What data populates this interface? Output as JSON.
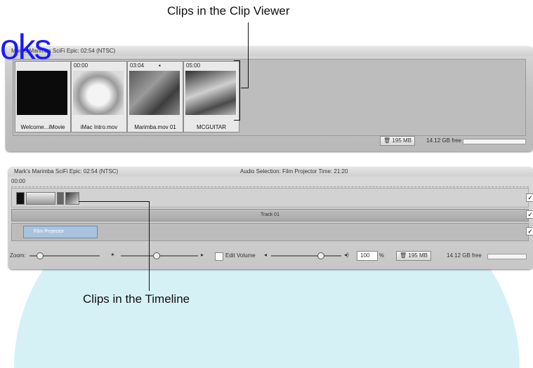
{
  "callouts": {
    "clip_viewer": "Clips in the Clip Viewer",
    "timeline": "Clips in the Timeline"
  },
  "overlay_brand": "oks",
  "clip_viewer": {
    "title": "Mark's Marimba SciFi Epic: 02:54 (NTSC)",
    "clips": [
      {
        "time": "",
        "name": "Welcome...iMovie"
      },
      {
        "time": "00:00",
        "name": "iMac Intro.mov"
      },
      {
        "time": "03:04",
        "name": "Marimba.mov 01"
      },
      {
        "time": "05:00",
        "name": "MCGUITAR"
      }
    ],
    "storage": "195 MB",
    "free": "14.12 GB free"
  },
  "timeline": {
    "title": "Mark's Marimba SciFi Epic: 02:54 (NTSC)",
    "audio_selection": "Audio Selection: Film Projector Time: 21:20",
    "ruler_start": "00:00",
    "track_label": "Track 01",
    "audio_clip": "Film Projector",
    "zoom_label": "Zoom:",
    "edit_volume_label": "Edit Volume",
    "volume_value": "100",
    "volume_unit": "%",
    "storage": "195 MB",
    "free": "14.12 GB free"
  }
}
